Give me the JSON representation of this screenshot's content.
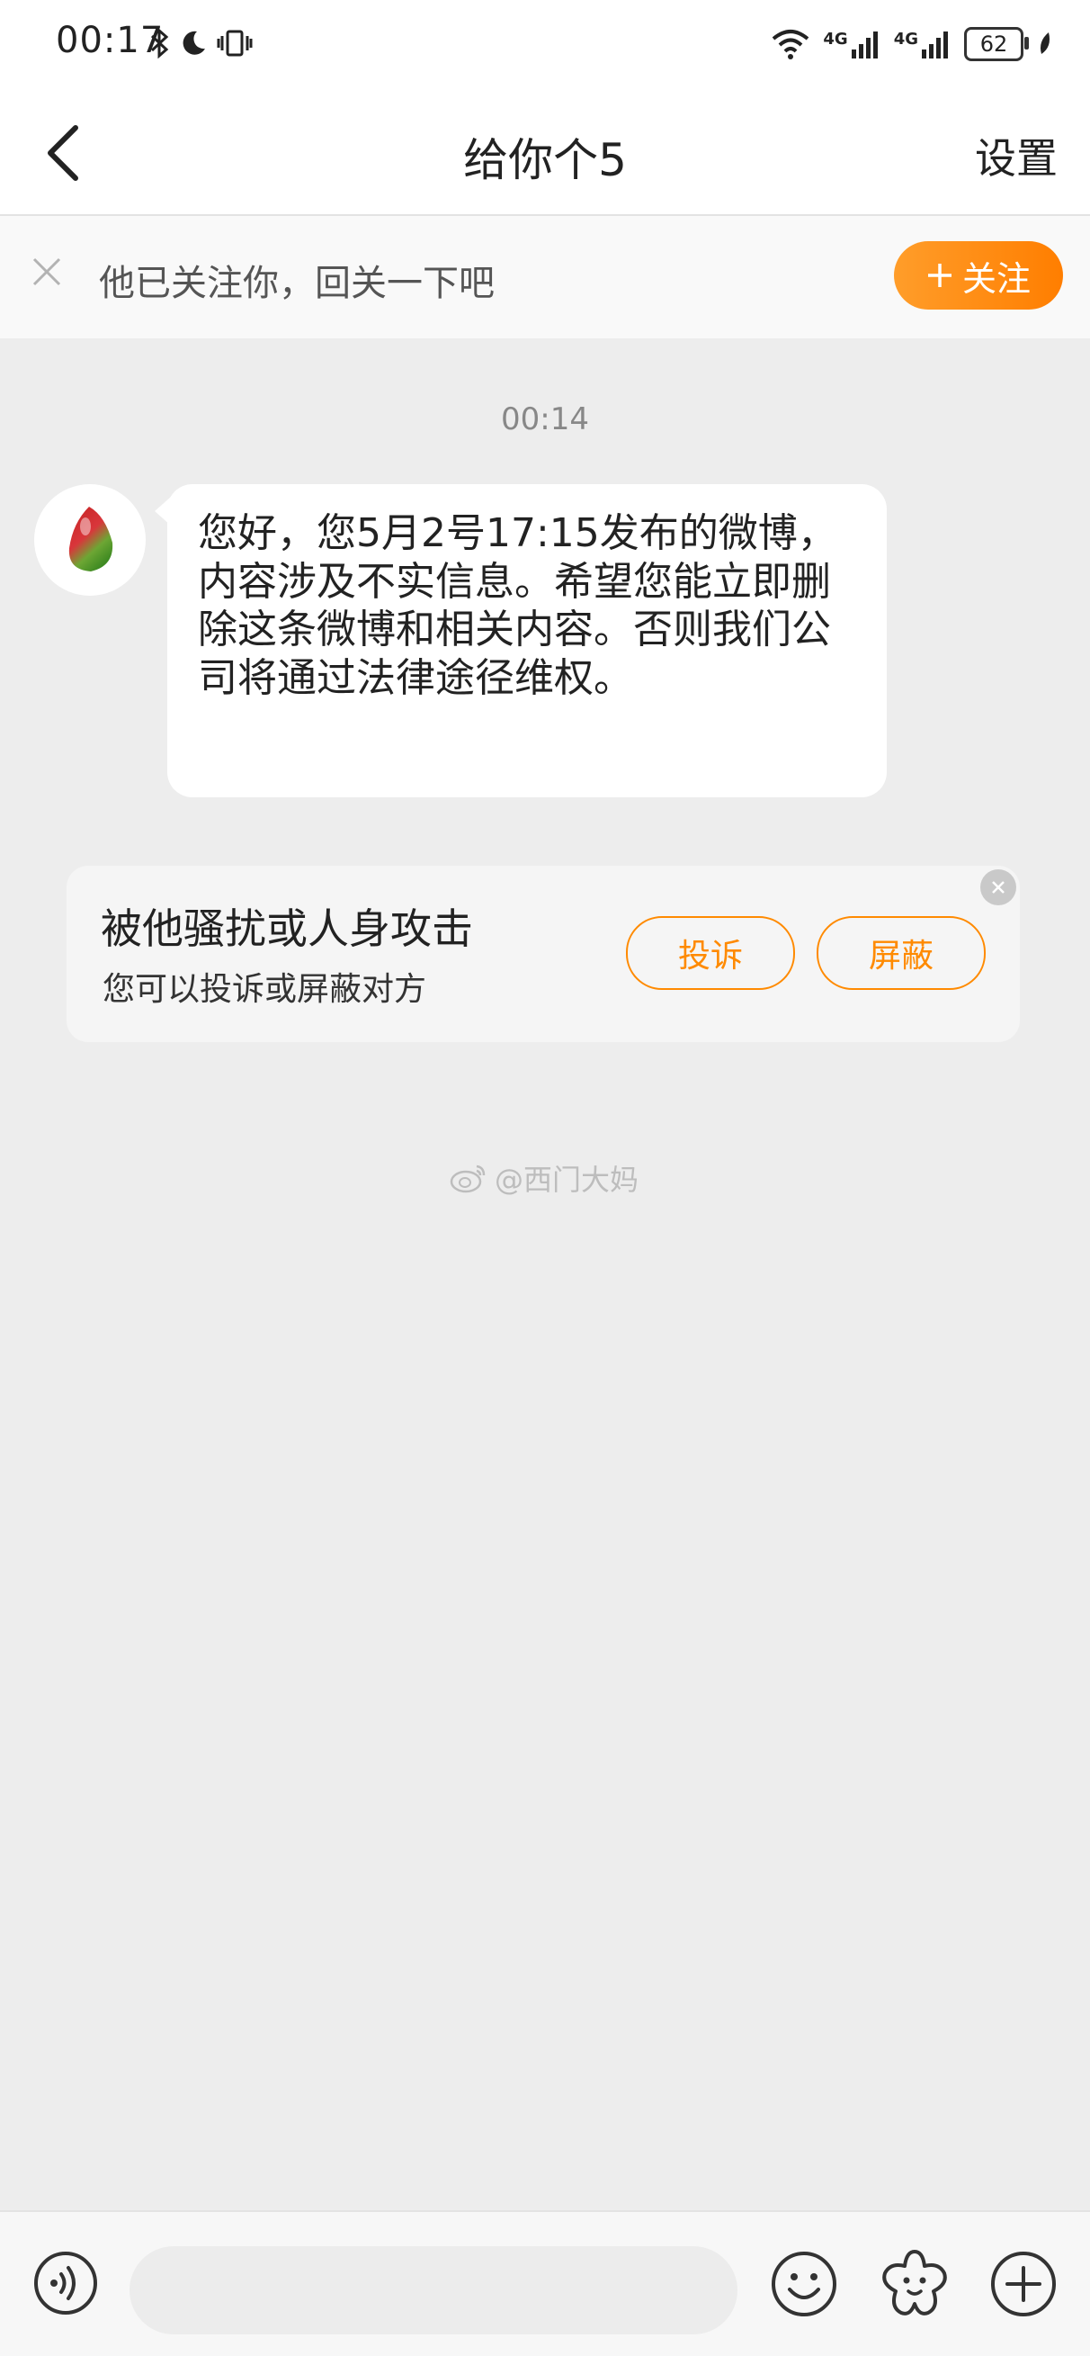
{
  "status_bar": {
    "time": "00:17",
    "battery": "62",
    "network_1": "4G",
    "network_2": "4G"
  },
  "nav": {
    "title": "给你个5",
    "settings_label": "设置"
  },
  "follow_banner": {
    "text": "他已关注你，回关一下吧",
    "follow_label": "关注"
  },
  "chat": {
    "timestamp": "00:14",
    "message": "您好，您5月2号17:15发布的微博，内容涉及不实信息。希望您能立即删除这条微博和相关内容。否则我们公司将通过法律途径维权。"
  },
  "report_card": {
    "title": "被他骚扰或人身攻击",
    "subtitle": "您可以投诉或屏蔽对方",
    "complain_label": "投诉",
    "block_label": "屏蔽"
  },
  "watermark": {
    "text": "@西门大妈"
  },
  "input_bar": {
    "placeholder": ""
  },
  "colors": {
    "accent": "#ff8a00",
    "background": "#ededed"
  },
  "icons": {
    "back": "back-icon",
    "close": "close-icon",
    "voice": "voice-icon",
    "emoji": "emoji-icon",
    "sticker": "sticker-icon",
    "plus": "plus-icon"
  }
}
